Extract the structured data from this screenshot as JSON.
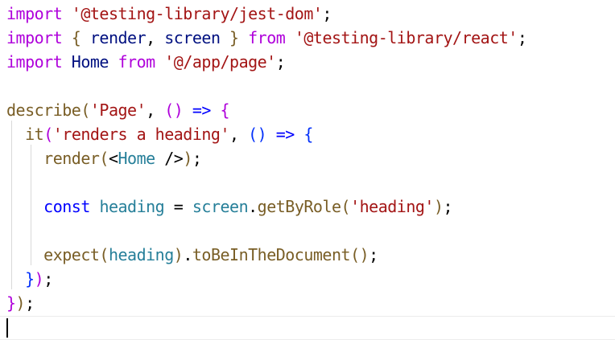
{
  "colors": {
    "keyword": "#af00db",
    "string": "#a31515",
    "variable": "#001080",
    "function": "#795e26",
    "storage": "#0000ff",
    "identifier": "#267f99",
    "bracket_gold": "#795e26",
    "bracket_purple": "#af00db",
    "bracket_blue": "#0431fa",
    "plain": "#000000"
  },
  "editor": {
    "lines": [
      [
        {
          "text": "import",
          "kind": "keyword"
        },
        {
          "text": " ",
          "kind": "plain"
        },
        {
          "text": "'@testing-library/jest-dom'",
          "kind": "string"
        },
        {
          "text": ";",
          "kind": "plain"
        }
      ],
      [
        {
          "text": "import",
          "kind": "keyword"
        },
        {
          "text": " ",
          "kind": "plain"
        },
        {
          "text": "{",
          "kind": "bracket_gold"
        },
        {
          "text": " ",
          "kind": "plain"
        },
        {
          "text": "render",
          "kind": "variable"
        },
        {
          "text": ", ",
          "kind": "plain"
        },
        {
          "text": "screen",
          "kind": "variable"
        },
        {
          "text": " ",
          "kind": "plain"
        },
        {
          "text": "}",
          "kind": "bracket_gold"
        },
        {
          "text": " ",
          "kind": "plain"
        },
        {
          "text": "from",
          "kind": "keyword"
        },
        {
          "text": " ",
          "kind": "plain"
        },
        {
          "text": "'@testing-library/react'",
          "kind": "string"
        },
        {
          "text": ";",
          "kind": "plain"
        }
      ],
      [
        {
          "text": "import",
          "kind": "keyword"
        },
        {
          "text": " ",
          "kind": "plain"
        },
        {
          "text": "Home",
          "kind": "variable"
        },
        {
          "text": " ",
          "kind": "plain"
        },
        {
          "text": "from",
          "kind": "keyword"
        },
        {
          "text": " ",
          "kind": "plain"
        },
        {
          "text": "'@/app/page'",
          "kind": "string"
        },
        {
          "text": ";",
          "kind": "plain"
        }
      ],
      [],
      [
        {
          "text": "describe",
          "kind": "function"
        },
        {
          "text": "(",
          "kind": "bracket_gold"
        },
        {
          "text": "'Page'",
          "kind": "string"
        },
        {
          "text": ", ",
          "kind": "plain"
        },
        {
          "text": "(",
          "kind": "bracket_purple"
        },
        {
          "text": ")",
          "kind": "bracket_purple"
        },
        {
          "text": " ",
          "kind": "plain"
        },
        {
          "text": "=>",
          "kind": "storage"
        },
        {
          "text": " ",
          "kind": "plain"
        },
        {
          "text": "{",
          "kind": "bracket_purple"
        }
      ],
      [
        {
          "text": "  ",
          "kind": "plain"
        },
        {
          "text": "it",
          "kind": "function"
        },
        {
          "text": "(",
          "kind": "bracket_purple"
        },
        {
          "text": "'renders a heading'",
          "kind": "string"
        },
        {
          "text": ", ",
          "kind": "plain"
        },
        {
          "text": "(",
          "kind": "bracket_blue"
        },
        {
          "text": ")",
          "kind": "bracket_blue"
        },
        {
          "text": " ",
          "kind": "plain"
        },
        {
          "text": "=>",
          "kind": "storage"
        },
        {
          "text": " ",
          "kind": "plain"
        },
        {
          "text": "{",
          "kind": "bracket_blue"
        }
      ],
      [
        {
          "text": "    ",
          "kind": "plain"
        },
        {
          "text": "render",
          "kind": "function"
        },
        {
          "text": "(",
          "kind": "bracket_gold"
        },
        {
          "text": "<",
          "kind": "plain"
        },
        {
          "text": "Home",
          "kind": "identifier"
        },
        {
          "text": " />",
          "kind": "plain"
        },
        {
          "text": ")",
          "kind": "bracket_gold"
        },
        {
          "text": ";",
          "kind": "plain"
        }
      ],
      [],
      [
        {
          "text": "    ",
          "kind": "plain"
        },
        {
          "text": "const",
          "kind": "storage"
        },
        {
          "text": " ",
          "kind": "plain"
        },
        {
          "text": "heading",
          "kind": "identifier"
        },
        {
          "text": " ",
          "kind": "plain"
        },
        {
          "text": "=",
          "kind": "plain"
        },
        {
          "text": " ",
          "kind": "plain"
        },
        {
          "text": "screen",
          "kind": "identifier"
        },
        {
          "text": ".",
          "kind": "plain"
        },
        {
          "text": "getByRole",
          "kind": "function"
        },
        {
          "text": "(",
          "kind": "bracket_gold"
        },
        {
          "text": "'heading'",
          "kind": "string"
        },
        {
          "text": ")",
          "kind": "bracket_gold"
        },
        {
          "text": ";",
          "kind": "plain"
        }
      ],
      [],
      [
        {
          "text": "    ",
          "kind": "plain"
        },
        {
          "text": "expect",
          "kind": "function"
        },
        {
          "text": "(",
          "kind": "bracket_gold"
        },
        {
          "text": "heading",
          "kind": "identifier"
        },
        {
          "text": ")",
          "kind": "bracket_gold"
        },
        {
          "text": ".",
          "kind": "plain"
        },
        {
          "text": "toBeInTheDocument",
          "kind": "function"
        },
        {
          "text": "(",
          "kind": "bracket_gold"
        },
        {
          "text": ")",
          "kind": "bracket_gold"
        },
        {
          "text": ";",
          "kind": "plain"
        }
      ],
      [
        {
          "text": "  ",
          "kind": "plain"
        },
        {
          "text": "}",
          "kind": "bracket_blue"
        },
        {
          "text": ")",
          "kind": "bracket_purple"
        },
        {
          "text": ";",
          "kind": "plain"
        }
      ],
      [
        {
          "text": "}",
          "kind": "bracket_purple"
        },
        {
          "text": ")",
          "kind": "bracket_gold"
        },
        {
          "text": ";",
          "kind": "plain"
        }
      ],
      []
    ]
  }
}
